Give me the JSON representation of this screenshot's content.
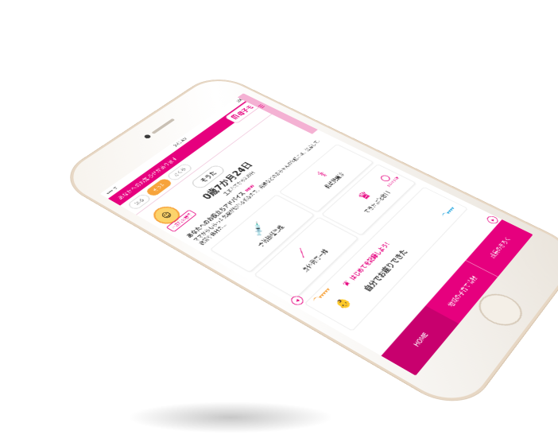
{
  "status_bar": {
    "time": "9:41 AM",
    "battery": "100%"
  },
  "notice": {
    "text": "あなたへのお知らせがあります"
  },
  "app": {
    "logo_text": "母子モ",
    "brand_color": "#e6007e"
  },
  "children": {
    "chips": [
      {
        "label": "はる",
        "active": false
      },
      {
        "label": "そうた",
        "active": true
      },
      {
        "label": "さくら",
        "active": false
      }
    ]
  },
  "profile": {
    "badge": "出産時の様子",
    "name": "そうた",
    "age": "0歳7か月24日",
    "born_since": "生まれてから239日"
  },
  "advice": {
    "title": "あなたへのお役立ちアドバイス",
    "new_label": "NEW",
    "body": "ママからもらった免疫が切れる頃なので、発熱などの赤ちゃんの体調には、注意して、夜間や休日の…"
  },
  "tiles": [
    {
      "label": "予防接種管理",
      "icon": "syringe-icon"
    },
    {
      "label": "乳幼児健診",
      "icon": "stethoscope-icon"
    },
    {
      "label": "身体発育曲線",
      "icon": "growth-curve-icon"
    },
    {
      "label": "できたよ記念日",
      "icon": "crown-icon"
    }
  ],
  "hint_label": "記念を記録",
  "banner": {
    "first_record": "はじめてを記録しよう！",
    "milestone": "自分でお座りできた"
  },
  "tabbar": {
    "home": "HOME",
    "local": "地域の子育て情報",
    "growth": "成長のきろく"
  }
}
